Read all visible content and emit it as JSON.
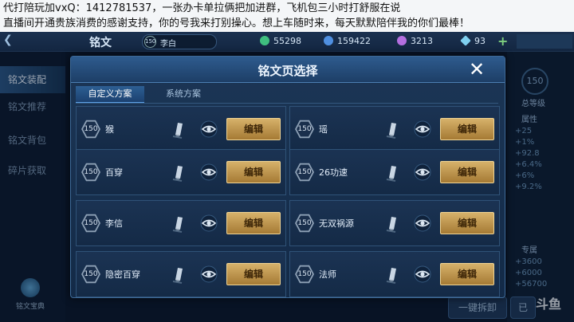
{
  "banner": {
    "line1": "代打陪玩加vxQ：1412781537，一张办卡单拉俩把加进群，飞机包三小时打舒服在说",
    "line2": "直播间开通贵族消费的感谢支持，你的号我来打别操心。想上车随时来，每天默默陪伴我的你们最棒！"
  },
  "topbar": {
    "title": "铭文",
    "hero_level": "150",
    "hero_name": "李白",
    "currencies": [
      {
        "name": "green-gem",
        "value": "55298",
        "color": "#3fbf7f"
      },
      {
        "name": "blue-coin",
        "value": "159422",
        "color": "#4f8fe0"
      },
      {
        "name": "purple-crystal",
        "value": "3213",
        "color": "#b46fe0"
      },
      {
        "name": "diamond",
        "value": "93",
        "color": "#7fd0f0"
      }
    ]
  },
  "leftnav": {
    "items": [
      "铭文装配",
      "铭文推荐",
      "铭文背包",
      "碎片获取"
    ],
    "active_index": 0,
    "bottom_label": "铭文宝典"
  },
  "rightpanel": {
    "level": "150",
    "level_label": "总等级",
    "attr_label": "属性",
    "values": [
      "+25",
      "+1%",
      "+92.8",
      "+6.4%",
      "+6%",
      "+9.2%"
    ],
    "section2_label": "专属",
    "values2": [
      "+3600",
      "+6000",
      "+56700"
    ],
    "btn_dismantle": "一键拆卸",
    "btn_other": "已"
  },
  "watermark": "斗鱼",
  "modal": {
    "title": "铭文页选择",
    "tabs": [
      "自定义方案",
      "系统方案"
    ],
    "active_tab": 0,
    "edit_label": "编辑",
    "pages": [
      {
        "level": "150",
        "name": "猴"
      },
      {
        "level": "150",
        "name": "瑶"
      },
      {
        "level": "150",
        "name": "百穿"
      },
      {
        "level": "150",
        "name": "26功速"
      },
      {
        "level": "150",
        "name": "李信"
      },
      {
        "level": "150",
        "name": "无双祸源"
      },
      {
        "level": "150",
        "name": "隐密百穿"
      },
      {
        "level": "150",
        "name": "法师"
      }
    ]
  }
}
